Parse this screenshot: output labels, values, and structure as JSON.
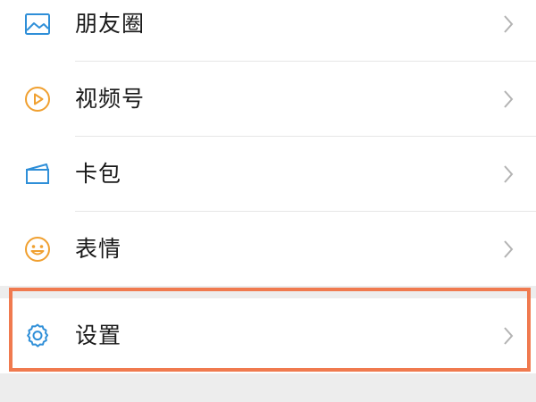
{
  "colors": {
    "blue_icon": "#2f8fd8",
    "orange_icon": "#f0a030",
    "chevron": "#b3b3b3",
    "highlight": "#f07a4f",
    "background": "#ededed",
    "row_bg": "#ffffff"
  },
  "menu": {
    "items": [
      {
        "label": "朋友圈",
        "icon": "moments-image-icon"
      },
      {
        "label": "视频号",
        "icon": "channels-play-icon"
      },
      {
        "label": "卡包",
        "icon": "card-wallet-icon"
      },
      {
        "label": "表情",
        "icon": "sticker-smiley-icon"
      }
    ],
    "settings": {
      "label": "设置",
      "icon": "settings-gear-icon"
    }
  }
}
